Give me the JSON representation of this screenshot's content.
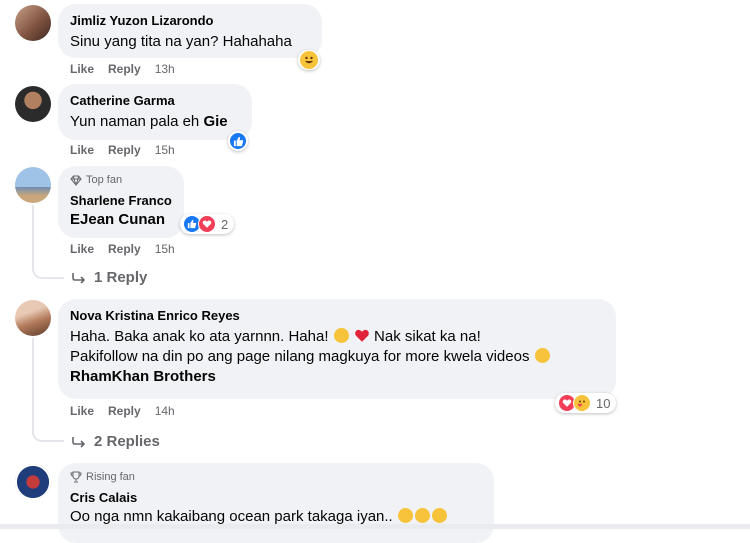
{
  "labels": {
    "like": "Like",
    "reply": "Reply"
  },
  "comments": [
    {
      "author": "Jimliz Yuzon Lizarondo",
      "text": "Sinu yang tita na yan? Hahahaha",
      "time": "13h",
      "reaction": "haha"
    },
    {
      "author": "Catherine Garma",
      "text": "Yun naman pala eh",
      "mention": "Gie",
      "time": "15h",
      "reaction": "like"
    },
    {
      "badge": "Top fan",
      "author": "Sharlene Franco",
      "mention": "EJean Cunan",
      "time": "15h",
      "reaction_count": "2",
      "replies_label": "1 Reply"
    },
    {
      "author": "Nova Kristina Enrico Reyes",
      "line1": "Haha. Baka anak ko ata yarnnn. Haha!",
      "line1b": "Nak sikat ka na!",
      "line2": "Pakifollow na din po ang page nilang magkuya for more kwela videos",
      "mention": "RhamKhan Brothers",
      "time": "14h",
      "reaction_count": "10",
      "replies_label": "2 Replies"
    },
    {
      "badge": "Rising fan",
      "author": "Cris Calais",
      "text": "Oo nga nmn kakaibang ocean park takaga iyan.."
    }
  ],
  "colors": {
    "bubble": "#f0f2f5",
    "meta": "#65676b",
    "like_blue": "#1877f2",
    "love_red": "#f33e58",
    "haha_yellow": "#f7c33a"
  }
}
